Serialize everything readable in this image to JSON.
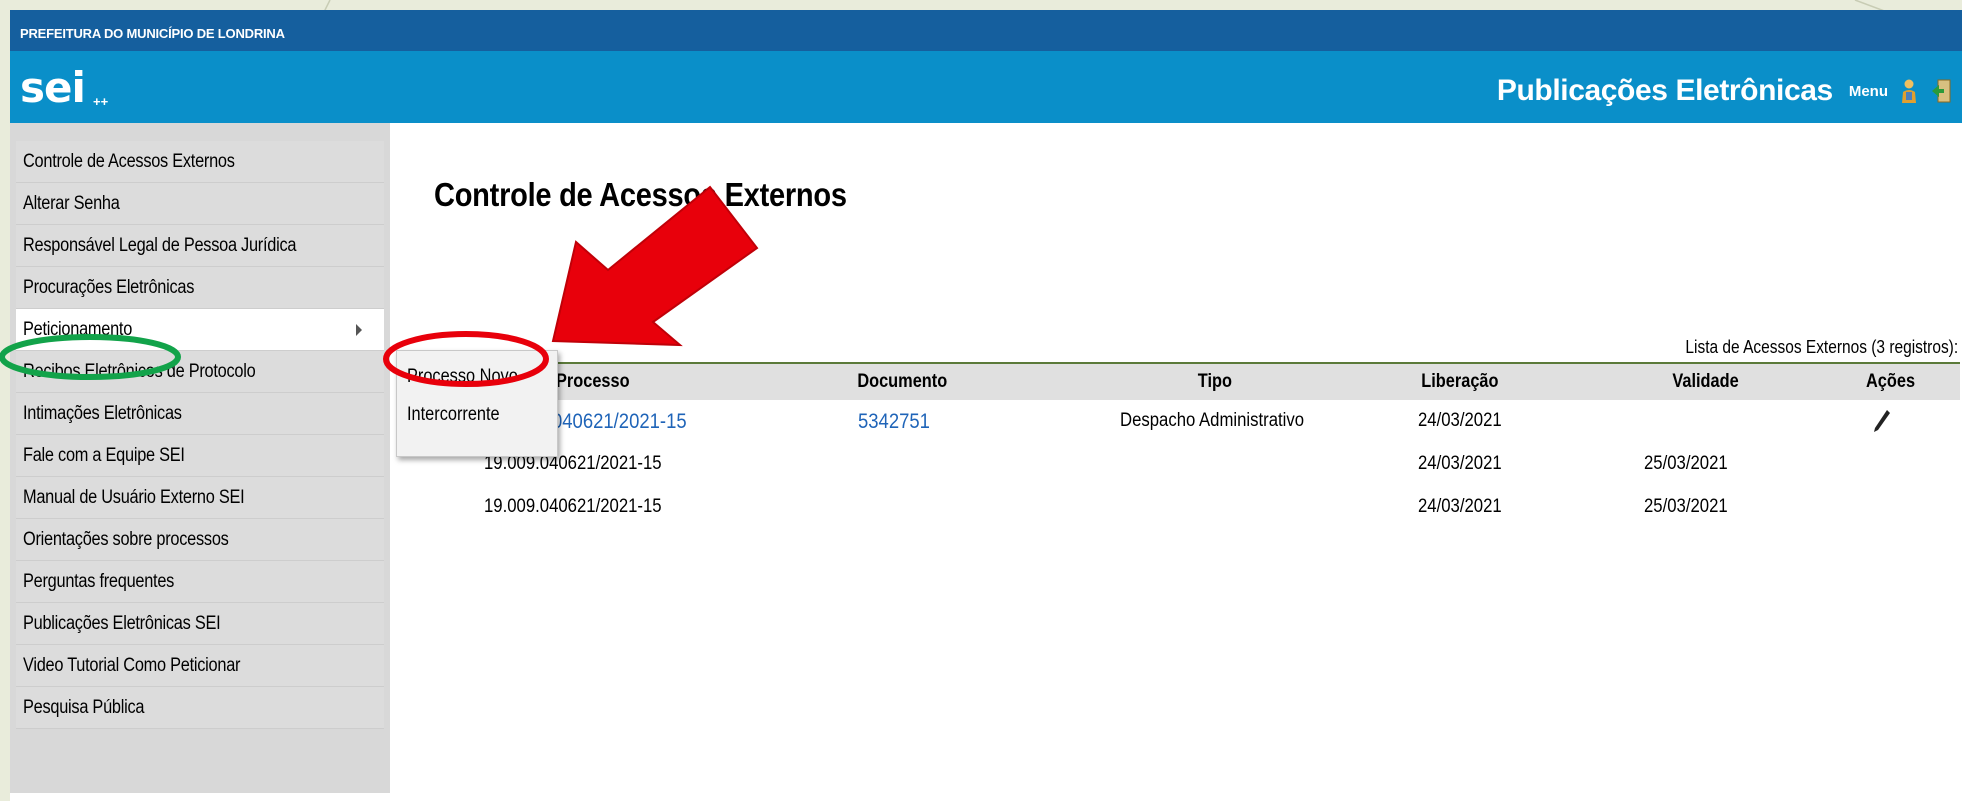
{
  "header": {
    "org_name": "PREFEITURA DO MUNICÍPIO DE LONDRINA",
    "logo_text": "sei",
    "logo_sup": "++",
    "title": "Publicações Eletrônicas",
    "menu_label": "Menu",
    "icons": [
      "user-icon",
      "exit-icon"
    ]
  },
  "sidebar": {
    "items": [
      {
        "label": "Controle de Acessos Externos"
      },
      {
        "label": "Alterar Senha"
      },
      {
        "label": "Responsável Legal de Pessoa Jurídica"
      },
      {
        "label": "Procurações Eletrônicas"
      },
      {
        "label": "Peticionamento"
      },
      {
        "label": "Recibos Eletrônicos de Protocolo"
      },
      {
        "label": "Intimações Eletrônicas"
      },
      {
        "label": "Fale com a Equipe SEI"
      },
      {
        "label": "Manual de Usuário Externo SEI"
      },
      {
        "label": "Orientações sobre processos"
      },
      {
        "label": "Perguntas frequentes"
      },
      {
        "label": "Publicações Eletrônicas SEI"
      },
      {
        "label": "Video Tutorial Como Peticionar"
      },
      {
        "label": "Pesquisa Pública"
      }
    ]
  },
  "submenu": {
    "items": [
      {
        "label": "Processo Novo"
      },
      {
        "label": "Intercorrente"
      }
    ]
  },
  "main": {
    "title": "Controle de Acessos Externos",
    "caption": "Lista de Acessos Externos (3 registros):",
    "columns": [
      "Processo",
      "Documento",
      "Tipo",
      "Liberação",
      "Validade",
      "Ações"
    ],
    "rows": [
      {
        "processo": "19.009.040621/2021-15",
        "processo_visible": "040621/2021-15",
        "documento": "5342751",
        "tipo": "Despacho Administrativo",
        "liberacao": "24/03/2021",
        "validade": "",
        "acao_icon": "pencil-icon"
      },
      {
        "processo": "19.009.040621/2021-15",
        "documento": "",
        "tipo": "",
        "liberacao": "24/03/2021",
        "validade": "25/03/2021"
      },
      {
        "processo": "19.009.040621/2021-15",
        "documento": "",
        "tipo": "",
        "liberacao": "24/03/2021",
        "validade": "25/03/2021"
      }
    ]
  },
  "colors": {
    "topbar": "#155f9e",
    "bluebar": "#0a8fc9",
    "link": "#1f64b8",
    "annotation_red": "#e8000b",
    "annotation_green": "#12a34a"
  }
}
